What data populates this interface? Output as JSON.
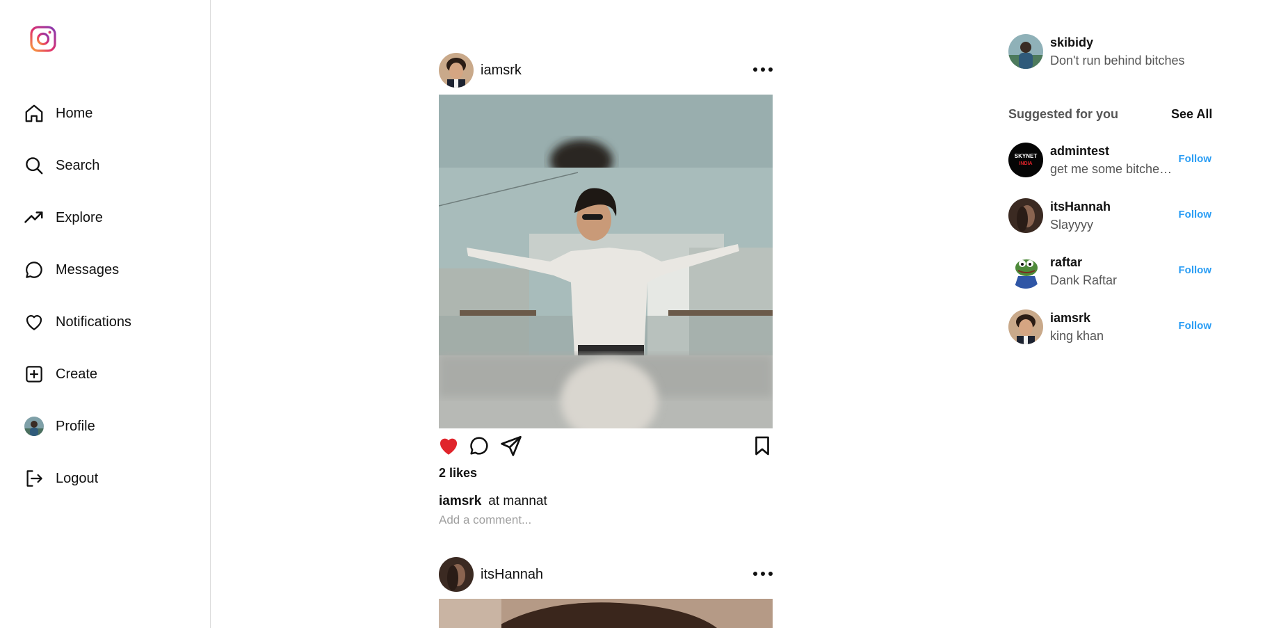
{
  "sidebar": {
    "logo_icon": "instagram-logo-icon",
    "items": [
      {
        "label": "Home",
        "icon": "home-icon"
      },
      {
        "label": "Search",
        "icon": "search-icon"
      },
      {
        "label": "Explore",
        "icon": "trending-icon"
      },
      {
        "label": "Messages",
        "icon": "message-circle-icon"
      },
      {
        "label": "Notifications",
        "icon": "heart-icon"
      },
      {
        "label": "Create",
        "icon": "plus-square-icon"
      },
      {
        "label": "Profile",
        "icon": "profile-avatar"
      },
      {
        "label": "Logout",
        "icon": "logout-icon"
      }
    ]
  },
  "feed": {
    "posts": [
      {
        "username": "iamsrk",
        "likes": "2 likes",
        "caption_user": "iamsrk",
        "caption_text": "at mannat",
        "comment_placeholder": "Add a comment...",
        "liked": true
      },
      {
        "username": "itsHannah"
      }
    ]
  },
  "right_panel": {
    "current_user": {
      "username": "skibidy",
      "bio": "Don't run behind bitches"
    },
    "suggested_label": "Suggested for you",
    "see_all": "See All",
    "suggestions": [
      {
        "username": "admintest",
        "bio": "get me some bitches ....",
        "follow": "Follow"
      },
      {
        "username": "itsHannah",
        "bio": "Slayyyy",
        "follow": "Follow"
      },
      {
        "username": "raftar",
        "bio": "Dank Raftar",
        "follow": "Follow"
      },
      {
        "username": "iamsrk",
        "bio": "king khan",
        "follow": "Follow"
      }
    ]
  },
  "colors": {
    "like_red": "#e0242b",
    "follow_blue": "#2a9df4",
    "border": "#dbdbdb"
  }
}
